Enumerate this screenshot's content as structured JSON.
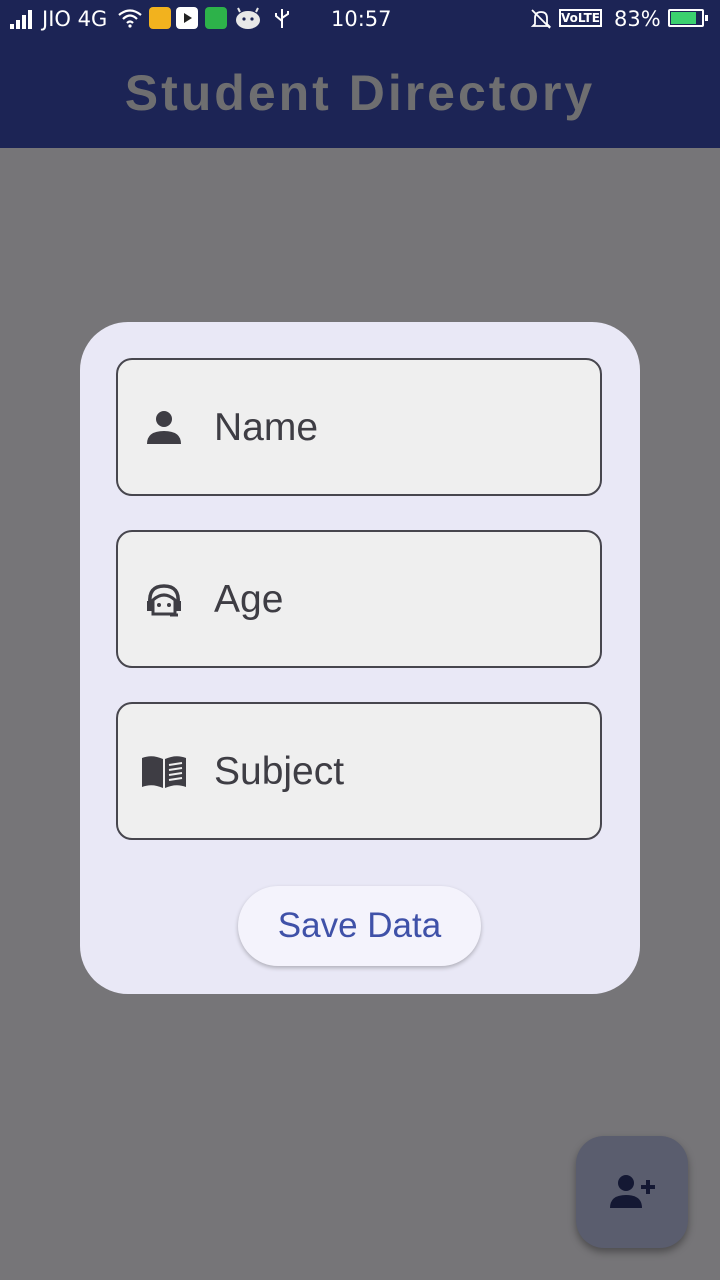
{
  "status_bar": {
    "carrier": "JIO 4G",
    "time": "10:57",
    "volte": "VoLTE",
    "battery_percent": "83%",
    "battery_level": 0.83,
    "icons": [
      "signal-icon",
      "wifi-icon",
      "tools-app-icon",
      "youtube-icon",
      "shopping-app-icon",
      "android-icon",
      "usb-icon",
      "mute-bell-icon",
      "battery-icon"
    ]
  },
  "app_bar": {
    "title": "Student Directory"
  },
  "form": {
    "fields": [
      {
        "label": "Name",
        "icon": "person-icon"
      },
      {
        "label": "Age",
        "icon": "face-icon"
      },
      {
        "label": "Subject",
        "icon": "book-icon"
      }
    ],
    "save_label": "Save Data"
  },
  "fab": {
    "icon": "add-person-icon"
  },
  "colors": {
    "app_bar": "#1c2455",
    "scrim": "#767578",
    "card": "#e9e8f6",
    "accent": "#3f51a8"
  }
}
